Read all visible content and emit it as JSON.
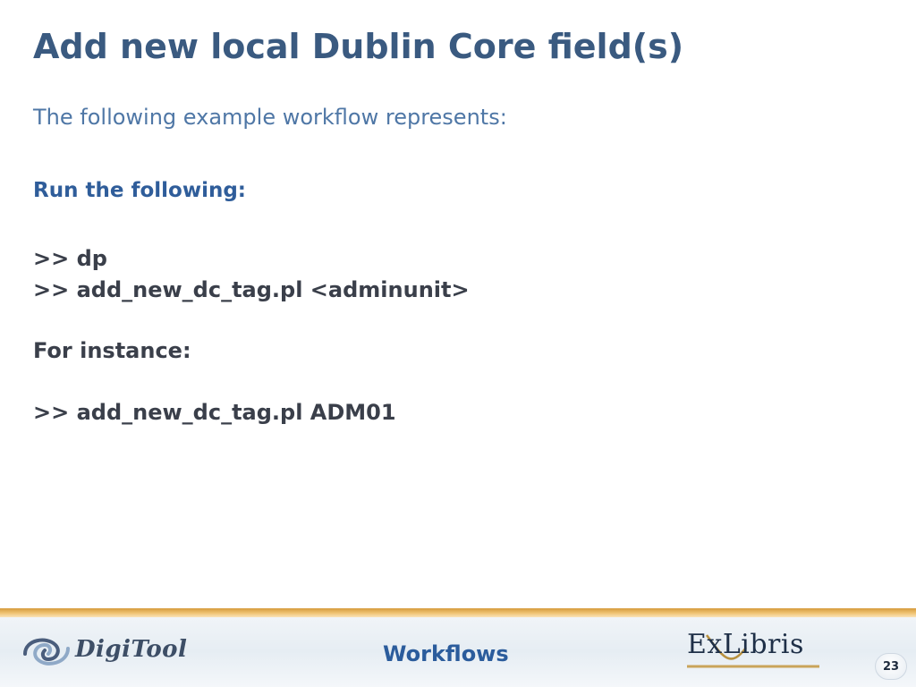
{
  "slide": {
    "title": "Add new local Dublin Core field(s)",
    "subtitle": "The following example workflow represents:",
    "run_heading": "Run the following:",
    "commands": [
      ">> dp",
      ">> add_new_dc_tag.pl <adminunit>"
    ],
    "instance_label": "For instance:",
    "instance_command": ">> add_new_dc_tag.pl ADM01"
  },
  "footer": {
    "left_logo": "DigiTool",
    "title": "Workflows",
    "right_logo": "ExLibris",
    "page_number": "23"
  },
  "colors": {
    "title": "#3a5a80",
    "subtitle": "#4f77a6",
    "heading": "#2f5d9a",
    "body_text": "#3a3f4a",
    "footer_title": "#2b5c9c",
    "accent_line": "#e8b35a"
  }
}
